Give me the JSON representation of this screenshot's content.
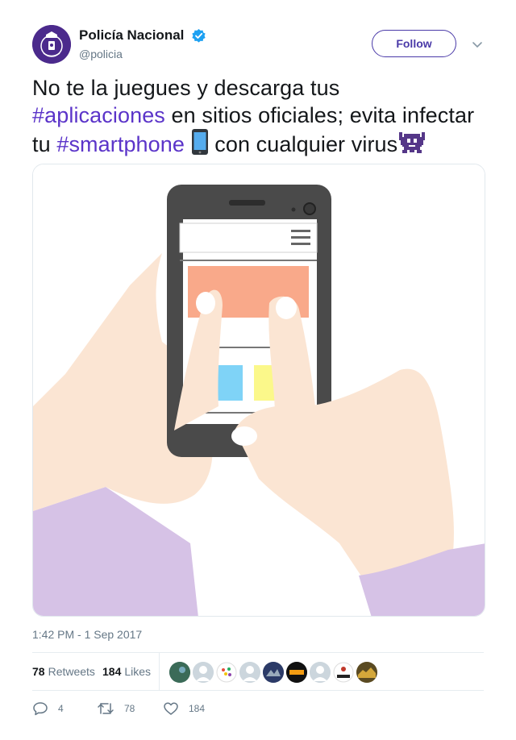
{
  "tweet": {
    "display_name": "Policía Nacional",
    "handle": "@policia",
    "follow_label": "Follow",
    "text_parts": {
      "p1": "No te la juegues y descarga tus",
      "hashtag1": "#aplicaciones",
      "p2": "en sitios oficiales; evita infectar",
      "p3": "tu",
      "hashtag2": "#smartphone",
      "p4": "con cualquier virus"
    },
    "emojis": [
      "mobile-phone-emoji",
      "alien-monster-emoji"
    ],
    "timestamp": "1:42 PM - 1 Sep 2017"
  },
  "stats": {
    "retweets_count": "78",
    "retweets_label": "Retweets",
    "likes_count": "184",
    "likes_label": "Likes",
    "likers_count": 9
  },
  "actions": {
    "replies": "4",
    "retweets": "78",
    "likes": "184"
  },
  "colors": {
    "hashtag": "#5b34c9",
    "follow_border": "#4a3aa8",
    "verified": "#1da1f2",
    "sleeve": "#d6c2e6",
    "skin": "#fbe5d3",
    "phone": "#4a4a4a"
  },
  "icons": [
    "verified-badge-icon",
    "chevron-down-icon",
    "reply-icon",
    "retweet-icon",
    "like-icon"
  ]
}
